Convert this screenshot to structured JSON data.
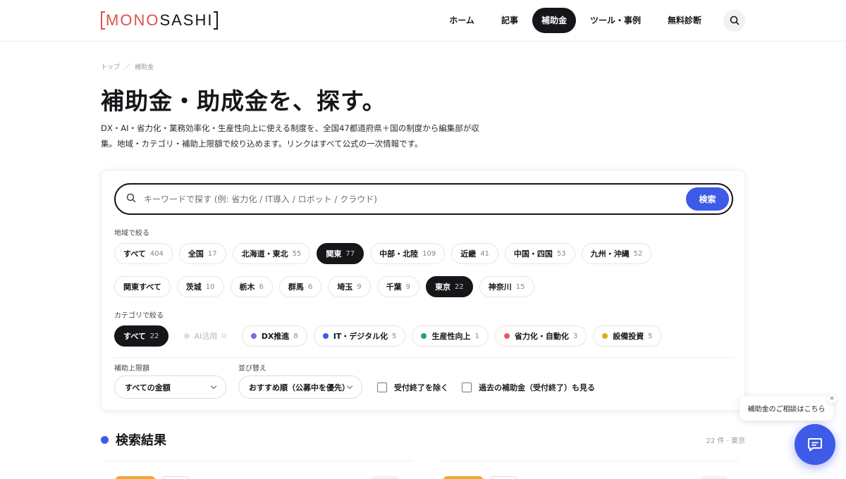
{
  "header": {
    "logo": {
      "part1": "MONO",
      "part2": "SASHI"
    },
    "nav": [
      {
        "label": "ホーム",
        "active": false
      },
      {
        "label": "記事",
        "active": false
      },
      {
        "label": "補助金",
        "active": true
      },
      {
        "label": "ツール・事例",
        "active": false
      },
      {
        "label": "無料診断",
        "active": false
      }
    ],
    "search_icon": "search-icon"
  },
  "breadcrumb": {
    "top": "トップ",
    "separator": "／",
    "current": "補助金"
  },
  "intro": {
    "title": "補助金・助成金を、探す。",
    "lead_line1": "DX・AI・省力化・業務効率化・生産性向上に使える制度を、全国47都道府県＋国の制度から編集部が収",
    "lead_line2": "集。地域・カテゴリ・補助上限額で絞り込めます。リンクはすべて公式の一次情報です。"
  },
  "search": {
    "placeholder": "キーワードで探す (例: 省力化 / IT導入 / ロボット / クラウド)",
    "value": "",
    "button": "検索"
  },
  "region_filter": {
    "label": "地域で絞る",
    "chips": [
      {
        "label": "すべて",
        "count": "404",
        "active": false
      },
      {
        "label": "全国",
        "count": "17",
        "active": false
      },
      {
        "label": "北海道・東北",
        "count": "55",
        "active": false
      },
      {
        "label": "関東",
        "count": "77",
        "active": true
      },
      {
        "label": "中部・北陸",
        "count": "109",
        "active": false
      },
      {
        "label": "近畿",
        "count": "41",
        "active": false
      },
      {
        "label": "中国・四国",
        "count": "53",
        "active": false
      },
      {
        "label": "九州・沖縄",
        "count": "52",
        "active": false
      }
    ],
    "prefectures": [
      {
        "label": "関東すべて",
        "count": "",
        "active": false
      },
      {
        "label": "茨城",
        "count": "10",
        "active": false
      },
      {
        "label": "栃木",
        "count": "6",
        "active": false
      },
      {
        "label": "群馬",
        "count": "6",
        "active": false
      },
      {
        "label": "埼玉",
        "count": "9",
        "active": false
      },
      {
        "label": "千葉",
        "count": "9",
        "active": false
      },
      {
        "label": "東京",
        "count": "22",
        "active": true
      },
      {
        "label": "神奈川",
        "count": "15",
        "active": false
      }
    ]
  },
  "category_filter": {
    "label": "カテゴリで絞る",
    "chips": [
      {
        "label": "すべて",
        "count": "22",
        "active": true,
        "dot": ""
      },
      {
        "label": "AI活用",
        "count": "0",
        "active": false,
        "dot": "#cde6f2",
        "muted": true
      },
      {
        "label": "DX推進",
        "count": "8",
        "active": false,
        "dot": "#8e5fe0"
      },
      {
        "label": "IT・デジタル化",
        "count": "5",
        "active": false,
        "dot": "#3d5be6"
      },
      {
        "label": "生産性向上",
        "count": "1",
        "active": false,
        "dot": "#22a55a"
      },
      {
        "label": "省力化・自動化",
        "count": "3",
        "active": false,
        "dot": "#e35d5d"
      },
      {
        "label": "設備投資",
        "count": "5",
        "active": false,
        "dot": "#e9a21a"
      }
    ]
  },
  "amount_filter": {
    "label": "補助上限額",
    "value": "すべての金額"
  },
  "sort": {
    "label": "並び替え",
    "value": "おすすめ順（公募中を優先）"
  },
  "checkboxes": {
    "exclude_closed": {
      "label": "受付終了を除く",
      "checked": false
    },
    "show_past": {
      "label": "過去の補助金（受付終了）も見る",
      "checked": false
    }
  },
  "results": {
    "title": "検索結果",
    "meta": "22 件 · 東京"
  },
  "chat": {
    "bubble": "補助金のご相談はこちら",
    "close": "×"
  },
  "colors": {
    "accent": "#3d5be6",
    "logo_red": "#e0504a",
    "active_chip": "#16161a",
    "tag_orange": "#f5a623"
  }
}
